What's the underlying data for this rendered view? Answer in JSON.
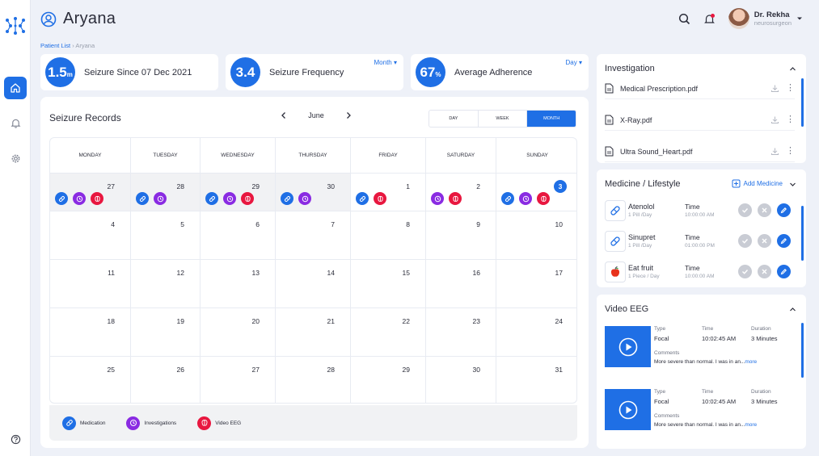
{
  "colors": {
    "accent": "#1f6fe5",
    "investigation": "#8a2be2",
    "eeg": "#e8173f"
  },
  "patient": {
    "name": "Aryana"
  },
  "breadcrumb": {
    "parent": "Patient List",
    "separator": "›",
    "current": "Aryana"
  },
  "doctor": {
    "name": "Dr. Rekha",
    "role": "neurosurgeon"
  },
  "stats": [
    {
      "value_main": "1.5",
      "value_unit": "m",
      "label": "Seizure Since 07 Dec 2021",
      "dropdown": ""
    },
    {
      "value_main": "3.4",
      "value_unit": "",
      "label": "Seizure Frequency",
      "dropdown": "Month"
    },
    {
      "value_main": "67",
      "value_unit": "%",
      "label": "Average Adherence",
      "dropdown": "Day"
    }
  ],
  "calendar": {
    "title": "Seizure Records",
    "month": "June",
    "views": [
      "DAY",
      "WEEK",
      "MONTH"
    ],
    "active_view": "MONTH",
    "weekdays": [
      "MONDAY",
      "TUESDAY",
      "WEDNESDAY",
      "THURSDAY",
      "FRIDAY",
      "SATURDAY",
      "SUNDAY"
    ],
    "weeks": [
      [
        {
          "day": "27",
          "past": true,
          "events": [
            "med",
            "inv",
            "eeg"
          ]
        },
        {
          "day": "28",
          "past": true,
          "events": [
            "med",
            "inv"
          ]
        },
        {
          "day": "29",
          "past": true,
          "events": [
            "med",
            "inv",
            "eeg"
          ]
        },
        {
          "day": "30",
          "past": true,
          "events": [
            "med",
            "inv"
          ]
        },
        {
          "day": "1",
          "past": false,
          "events": [
            "med",
            "eeg"
          ]
        },
        {
          "day": "2",
          "past": false,
          "events": [
            "inv",
            "eeg"
          ]
        },
        {
          "day": "3",
          "past": false,
          "today": true,
          "events": [
            "med",
            "inv",
            "eeg"
          ]
        }
      ],
      [
        {
          "day": "4"
        },
        {
          "day": "5"
        },
        {
          "day": "6"
        },
        {
          "day": "7"
        },
        {
          "day": "8"
        },
        {
          "day": "9"
        },
        {
          "day": "10"
        }
      ],
      [
        {
          "day": "11"
        },
        {
          "day": "12"
        },
        {
          "day": "13"
        },
        {
          "day": "14"
        },
        {
          "day": "15"
        },
        {
          "day": "16"
        },
        {
          "day": "17"
        }
      ],
      [
        {
          "day": "18"
        },
        {
          "day": "19"
        },
        {
          "day": "20"
        },
        {
          "day": "21"
        },
        {
          "day": "22"
        },
        {
          "day": "23"
        },
        {
          "day": "24"
        }
      ],
      [
        {
          "day": "25"
        },
        {
          "day": "26"
        },
        {
          "day": "27"
        },
        {
          "day": "28"
        },
        {
          "day": "29"
        },
        {
          "day": "30"
        },
        {
          "day": "31"
        }
      ]
    ],
    "legend": {
      "med": "Medication",
      "inv": "Investigations",
      "eeg": "Video EEG"
    }
  },
  "investigation": {
    "title": "Investigation",
    "files": [
      "Medical Prescription.pdf",
      "X-Ray.pdf",
      "Ultra Sound_Heart.pdf"
    ]
  },
  "medicine": {
    "title": "Medicine / Lifestyle",
    "add_label": "Add Medicine",
    "items": [
      {
        "name": "Atenolol",
        "dose": "1 Pill /Day",
        "time_label": "Time",
        "time": "10:00:00 AM",
        "icon": "pill-icon"
      },
      {
        "name": "Sinupret",
        "dose": "1 Pill /Day",
        "time_label": "Time",
        "time": "01:00:00 PM",
        "icon": "pill-icon"
      },
      {
        "name": "Eat fruit",
        "dose": "1 Piece / Day",
        "time_label": "Time",
        "time": "10:00:00 AM",
        "icon": "apple-icon"
      }
    ]
  },
  "video_eeg": {
    "title": "Video EEG",
    "col_type": "Type",
    "col_time": "Time",
    "col_duration": "Duration",
    "col_comments": "Comments",
    "items": [
      {
        "type": "Focal",
        "time": "10:02:45 AM",
        "duration": "3 Minutes",
        "comment": "More severe than normal. I was in an...",
        "more": "more"
      },
      {
        "type": "Focal",
        "time": "10:02:45 AM",
        "duration": "3 Minutes",
        "comment": "More severe than normal. I was in an...",
        "more": "more"
      }
    ]
  }
}
